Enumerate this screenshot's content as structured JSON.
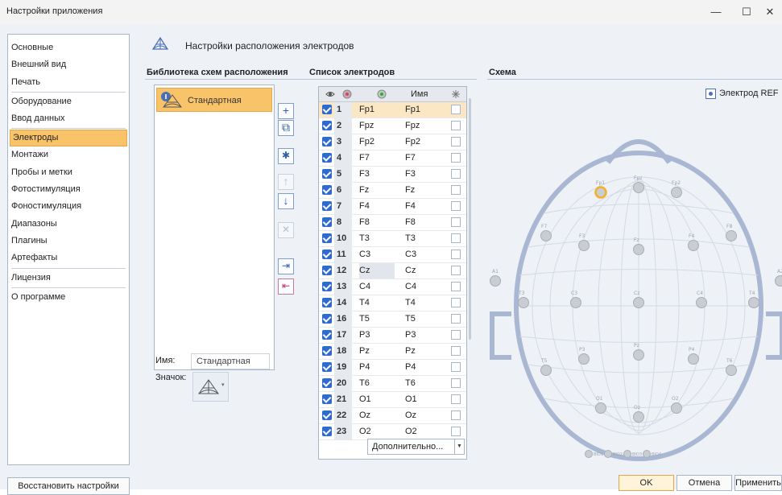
{
  "window": {
    "title": "Настройки приложения",
    "controls": [
      "—",
      "☐",
      "✕"
    ]
  },
  "sidebar": {
    "items": [
      {
        "label": "Основные"
      },
      {
        "label": "Внешний вид"
      },
      {
        "label": "Печать"
      },
      {
        "label": "Оборудование"
      },
      {
        "label": "Ввод данных"
      },
      {
        "label": "Электроды",
        "active": true
      },
      {
        "label": "Монтажи"
      },
      {
        "label": "Пробы и метки"
      },
      {
        "label": "Фотостимуляция"
      },
      {
        "label": "Фоностимуляция"
      },
      {
        "label": "Диапазоны"
      },
      {
        "label": "Плагины"
      },
      {
        "label": "Артефакты"
      },
      {
        "label": "Лицензия"
      },
      {
        "label": "О программе"
      }
    ],
    "restore_button": "Восстановить настройки"
  },
  "header": {
    "title": "Настройки расположения электродов",
    "icon": "head-scheme-icon"
  },
  "library": {
    "title": "Библиотека схем расположения",
    "items": [
      {
        "label": "Стандартная",
        "selected": true
      }
    ],
    "name_label": "Имя:",
    "name_value": "Стандартная",
    "icon_label": "Значок:"
  },
  "toolbar": {
    "buttons": [
      {
        "name": "add",
        "glyph": "+",
        "enabled": true
      },
      {
        "name": "copy",
        "glyph": "⧉",
        "enabled": true
      },
      {
        "name": "star",
        "glyph": "✱",
        "enabled": true
      },
      {
        "name": "move-up",
        "glyph": "↑",
        "enabled": false
      },
      {
        "name": "move-down",
        "glyph": "↓",
        "enabled": true
      },
      {
        "name": "delete",
        "glyph": "✕",
        "enabled": false
      },
      {
        "name": "import",
        "glyph": "⇥",
        "enabled": true
      },
      {
        "name": "export",
        "glyph": "⇤",
        "enabled": true
      }
    ]
  },
  "electrodes": {
    "title": "Список электродов",
    "columns": {
      "name": "Имя"
    },
    "rows": [
      {
        "n": "1",
        "label": "Fp1",
        "name": "Fp1",
        "selected": true
      },
      {
        "n": "2",
        "label": "Fpz",
        "name": "Fpz"
      },
      {
        "n": "3",
        "label": "Fp2",
        "name": "Fp2"
      },
      {
        "n": "4",
        "label": "F7",
        "name": "F7"
      },
      {
        "n": "5",
        "label": "F3",
        "name": "F3"
      },
      {
        "n": "6",
        "label": "Fz",
        "name": "Fz"
      },
      {
        "n": "7",
        "label": "F4",
        "name": "F4"
      },
      {
        "n": "8",
        "label": "F8",
        "name": "F8"
      },
      {
        "n": "10",
        "label": "T3",
        "name": "T3"
      },
      {
        "n": "11",
        "label": "C3",
        "name": "C3"
      },
      {
        "n": "12",
        "label": "Cz",
        "name": "Cz",
        "gray": true
      },
      {
        "n": "13",
        "label": "C4",
        "name": "C4"
      },
      {
        "n": "14",
        "label": "T4",
        "name": "T4"
      },
      {
        "n": "16",
        "label": "T5",
        "name": "T5"
      },
      {
        "n": "17",
        "label": "P3",
        "name": "P3"
      },
      {
        "n": "18",
        "label": "Pz",
        "name": "Pz"
      },
      {
        "n": "19",
        "label": "P4",
        "name": "P4"
      },
      {
        "n": "20",
        "label": "T6",
        "name": "T6"
      },
      {
        "n": "21",
        "label": "O1",
        "name": "O1"
      },
      {
        "n": "22",
        "label": "Oz",
        "name": "Oz"
      },
      {
        "n": "23",
        "label": "O2",
        "name": "O2"
      }
    ],
    "more_button": "Дополнительно..."
  },
  "scheme": {
    "title": "Схема",
    "ref_label": "Электрод REF",
    "electrodes": [
      {
        "label": "Fp1",
        "selected": true
      },
      {
        "label": "Fpz"
      },
      {
        "label": "Fp2"
      },
      {
        "label": "F7"
      },
      {
        "label": "F3"
      },
      {
        "label": "Fz"
      },
      {
        "label": "F4"
      },
      {
        "label": "F8"
      },
      {
        "label": "A1"
      },
      {
        "label": "T3"
      },
      {
        "label": "C3"
      },
      {
        "label": "Cz"
      },
      {
        "label": "C4"
      },
      {
        "label": "T4"
      },
      {
        "label": "A2"
      },
      {
        "label": "T5"
      },
      {
        "label": "P3"
      },
      {
        "label": "Pz"
      },
      {
        "label": "P4"
      },
      {
        "label": "T6"
      },
      {
        "label": "O1"
      },
      {
        "label": "Oz"
      },
      {
        "label": "O2"
      }
    ],
    "bio": [
      "BIO1",
      "BIO2",
      "BIO3",
      "BIO4"
    ]
  },
  "actions": {
    "ok": "OK",
    "cancel": "Отмена",
    "apply": "Применить"
  },
  "colors": {
    "accent": "#f9c36a",
    "head_outline": "#a9b7d3",
    "check": "#2f6ad0"
  }
}
